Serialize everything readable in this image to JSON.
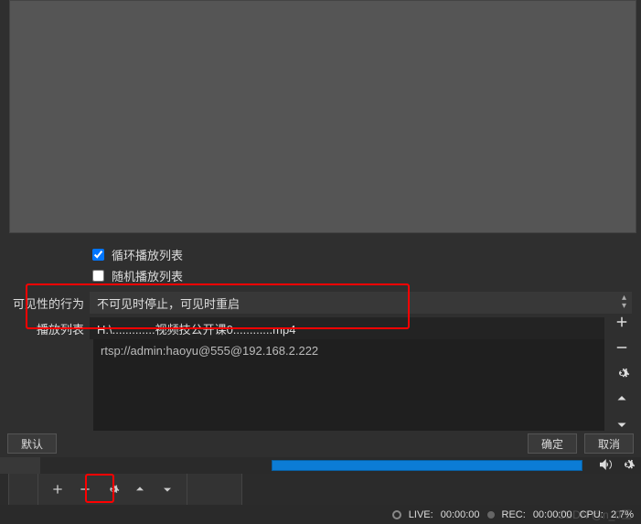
{
  "preview": {},
  "options": {
    "loop_label": "循环播放列表",
    "loop_checked": true,
    "shuffle_label": "随机播放列表",
    "shuffle_checked": false
  },
  "visibility": {
    "label": "可见性的行为",
    "selected": "不可见时停止，可见时重启"
  },
  "playlist": {
    "label": "播放列表",
    "input_value": "H:\\.............视频技公开课0............mp4",
    "items": [
      "rtsp://admin:haoyu@555@192.168.2.222"
    ]
  },
  "buttons": {
    "default": "默认",
    "ok": "确定",
    "cancel": "取消"
  },
  "status": {
    "live_label": "LIVE:",
    "live_time": "00:00:00",
    "rec_label": "REC:",
    "rec_time": "00:00:00",
    "cpu_label": "CPU:",
    "cpu_value": "2.7%"
  },
  "watermark": "CSDN @n_0王"
}
